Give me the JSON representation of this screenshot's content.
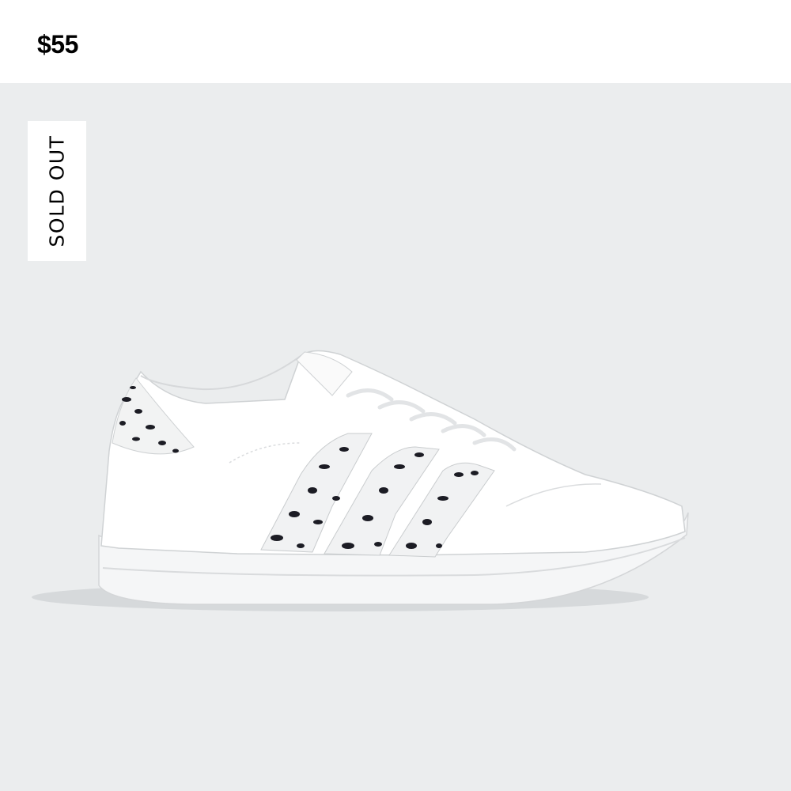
{
  "product": {
    "price": "$55",
    "badge": "SOLD OUT",
    "image_icon": "sneaker-image",
    "colors": {
      "background": "#ebedee",
      "header": "#ffffff",
      "text": "#000000"
    }
  }
}
